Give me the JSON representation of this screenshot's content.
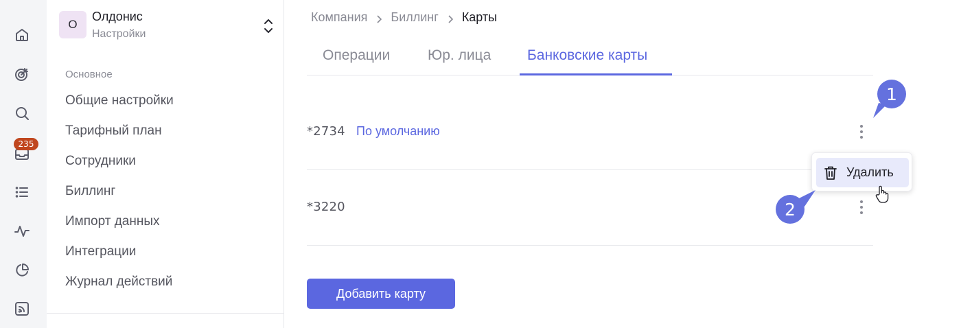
{
  "rail": {
    "inbox_badge": "235"
  },
  "org": {
    "avatar_letter": "О",
    "name": "Олдонис",
    "subtitle": "Настройки"
  },
  "sidebar": {
    "section_label": "Основное",
    "items": [
      {
        "label": "Общие настройки"
      },
      {
        "label": "Тарифный план"
      },
      {
        "label": "Сотрудники"
      },
      {
        "label": "Биллинг"
      },
      {
        "label": "Импорт данных"
      },
      {
        "label": "Интеграции"
      },
      {
        "label": "Журнал действий"
      }
    ]
  },
  "breadcrumbs": [
    "Компания",
    "Биллинг",
    "Карты"
  ],
  "tabs": [
    {
      "label": "Операции",
      "active": false
    },
    {
      "label": "Юр. лица",
      "active": false
    },
    {
      "label": "Банковские карты",
      "active": true
    }
  ],
  "cards": [
    {
      "number": "*2734",
      "default_label": "По умолчанию"
    },
    {
      "number": "*3220",
      "default_label": ""
    }
  ],
  "menu": {
    "delete_label": "Удалить"
  },
  "callouts": [
    "1",
    "2"
  ],
  "add_card_label": "Добавить карту",
  "colors": {
    "accent": "#5b67e0",
    "callout": "#6471de",
    "badge": "#c0461e",
    "rail_bg": "#f4f5f7"
  }
}
